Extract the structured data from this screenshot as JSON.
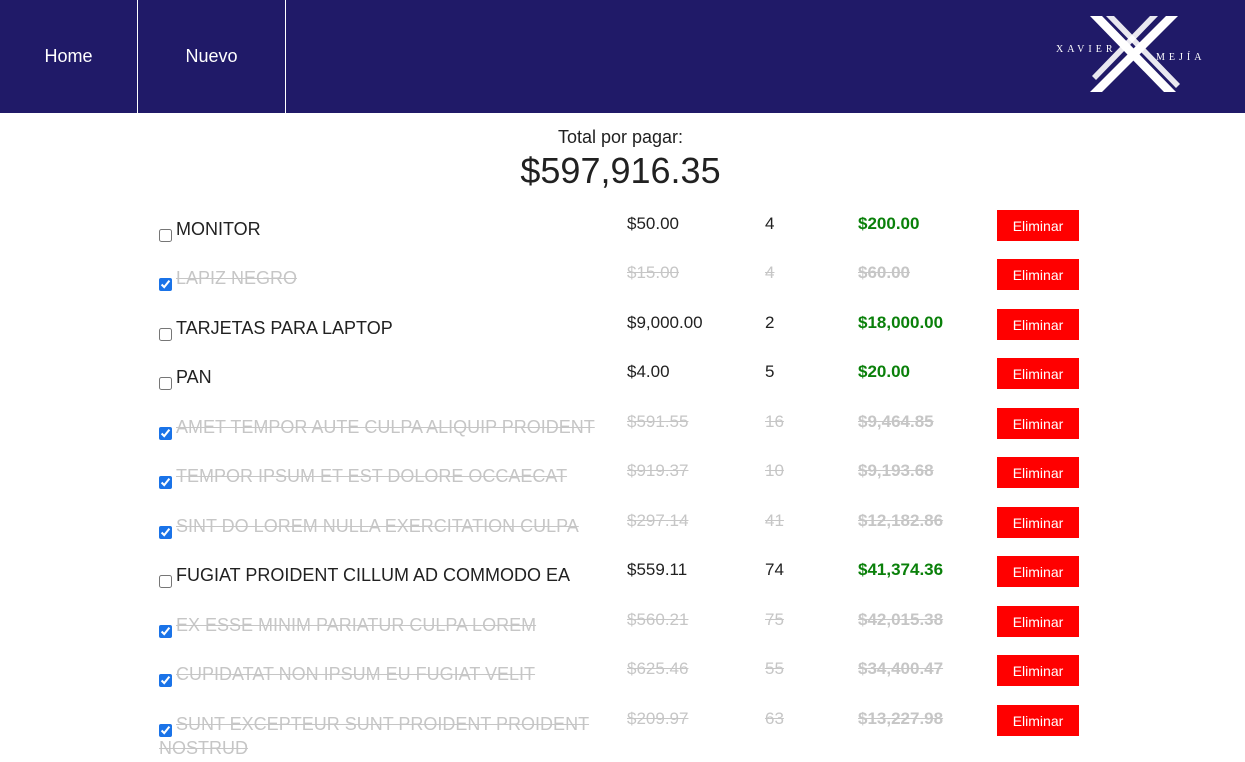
{
  "nav": {
    "home": "Home",
    "nuevo": "Nuevo"
  },
  "logo": {
    "left_word": "XAVIER",
    "right_word": "MEJÍA",
    "mark": "x-logo-icon"
  },
  "summary": {
    "label": "Total por pagar:",
    "total": "$597,916.35"
  },
  "delete_label": "Eliminar",
  "colors": {
    "navbar": "#201a68",
    "delete_button": "#ff0000",
    "subtotal": "#0a800a",
    "completed_text": "#c6c6c6"
  },
  "items": [
    {
      "name": "MONITOR",
      "price": "$50.00",
      "qty": "4",
      "subtotal": "$200.00",
      "checked": false
    },
    {
      "name": "LAPIZ NEGRO",
      "price": "$15.00",
      "qty": "4",
      "subtotal": "$60.00",
      "checked": true
    },
    {
      "name": "TARJETAS PARA LAPTOP",
      "price": "$9,000.00",
      "qty": "2",
      "subtotal": "$18,000.00",
      "checked": false
    },
    {
      "name": "PAN",
      "price": "$4.00",
      "qty": "5",
      "subtotal": "$20.00",
      "checked": false
    },
    {
      "name": "AMET TEMPOR AUTE CULPA ALIQUIP PROIDENT",
      "price": "$591.55",
      "qty": "16",
      "subtotal": "$9,464.85",
      "checked": true
    },
    {
      "name": "TEMPOR IPSUM ET EST DOLORE OCCAECAT",
      "price": "$919.37",
      "qty": "10",
      "subtotal": "$9,193.68",
      "checked": true
    },
    {
      "name": "SINT DO LOREM NULLA EXERCITATION CULPA",
      "price": "$297.14",
      "qty": "41",
      "subtotal": "$12,182.86",
      "checked": true
    },
    {
      "name": "FUGIAT PROIDENT CILLUM AD COMMODO EA",
      "price": "$559.11",
      "qty": "74",
      "subtotal": "$41,374.36",
      "checked": false
    },
    {
      "name": "EX ESSE MINIM PARIATUR CULPA LOREM",
      "price": "$560.21",
      "qty": "75",
      "subtotal": "$42,015.38",
      "checked": true
    },
    {
      "name": "CUPIDATAT NON IPSUM EU FUGIAT VELIT",
      "price": "$625.46",
      "qty": "55",
      "subtotal": "$34,400.47",
      "checked": true
    },
    {
      "name": "SUNT EXCEPTEUR SUNT PROIDENT PROIDENT NOSTRUD",
      "price": "$209.97",
      "qty": "63",
      "subtotal": "$13,227.98",
      "checked": true
    }
  ]
}
